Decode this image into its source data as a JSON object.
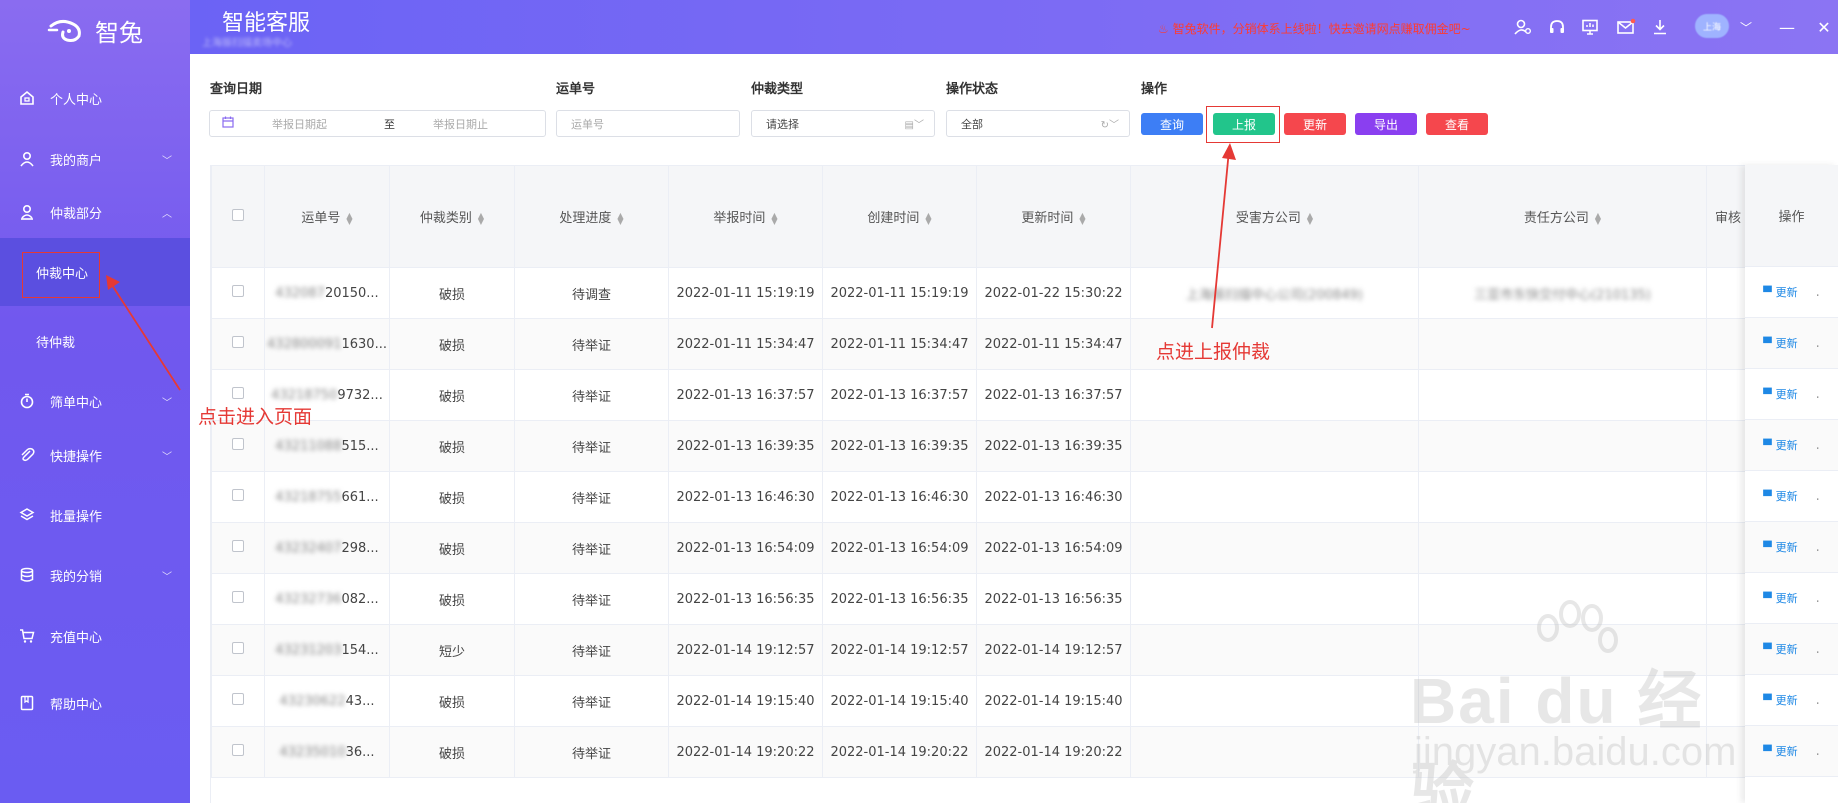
{
  "brand": {
    "name": "智兔"
  },
  "sidebar": {
    "items": [
      {
        "label": "个人中心",
        "icon": "house-icon"
      },
      {
        "label": "我的商户",
        "icon": "user-icon",
        "chevron": true
      },
      {
        "label": "仲裁部分",
        "icon": "user-icon",
        "chevron": true
      },
      {
        "label": "筛单中心",
        "icon": "timer-icon",
        "chevron": true
      },
      {
        "label": "快捷操作",
        "icon": "paperclip-icon",
        "chevron": true
      },
      {
        "label": "批量操作",
        "icon": "layers-icon"
      },
      {
        "label": "我的分销",
        "icon": "database-icon",
        "chevron": true
      },
      {
        "label": "充值中心",
        "icon": "cart-icon"
      },
      {
        "label": "帮助中心",
        "icon": "book-icon"
      }
    ],
    "sub_items": [
      "仲裁中心",
      "待仲裁"
    ]
  },
  "header": {
    "title": "智能客服",
    "subtitle": "上海振扫描卖场中心",
    "notice": "♨ 智兔软件，分销体系上线啦！快去邀请网点赚取佣金吧~",
    "avatar_text": "上海"
  },
  "filters": {
    "date_label": "查询日期",
    "date_start_placeholder": "举报日期起",
    "date_sep": "至",
    "date_end_placeholder": "举报日期止",
    "waybill_label": "运单号",
    "waybill_placeholder": "运单号",
    "type_label": "仲裁类型",
    "type_value": "请选择",
    "status_label": "操作状态",
    "status_value": "全部",
    "ops_label": "操作"
  },
  "buttons": {
    "query": "查询",
    "report": "上报",
    "update": "更新",
    "export": "导出",
    "view": "查看"
  },
  "colors": {
    "query": "#3d7ef5",
    "report": "#22c58b",
    "update": "#f5474d",
    "export": "#8a3ff0",
    "view": "#f5474d"
  },
  "table": {
    "columns": [
      "运单号",
      "仲裁类别",
      "处理进度",
      "举报时间",
      "创建时间",
      "更新时间",
      "受害方公司",
      "责任方公司",
      "审核",
      "操作"
    ],
    "op_label": "更新",
    "rows": [
      {
        "waybill_hidden": "432087",
        "waybill": "20150...",
        "type": "破损",
        "progress": "待调查",
        "report": "2022-01-11 15:19:19",
        "created": "2022-01-11 15:19:19",
        "updated": "2022-01-22 15:30:22",
        "victim": "上海振扫描中心公司(200849)",
        "resp": "三亚市东快交付中心(210135)"
      },
      {
        "waybill_hidden": "432800091",
        "waybill": "1630...",
        "type": "破损",
        "progress": "待举证",
        "report": "2022-01-11 15:34:47",
        "created": "2022-01-11 15:34:47",
        "updated": "2022-01-11 15:34:47",
        "victim": "",
        "resp": ""
      },
      {
        "waybill_hidden": "43218750",
        "waybill": "9732...",
        "type": "破损",
        "progress": "待举证",
        "report": "2022-01-13 16:37:57",
        "created": "2022-01-13 16:37:57",
        "updated": "2022-01-13 16:37:57",
        "victim": "",
        "resp": ""
      },
      {
        "waybill_hidden": "43211088",
        "waybill": "515...",
        "type": "破损",
        "progress": "待举证",
        "report": "2022-01-13 16:39:35",
        "created": "2022-01-13 16:39:35",
        "updated": "2022-01-13 16:39:35",
        "victim": "",
        "resp": ""
      },
      {
        "waybill_hidden": "43218755",
        "waybill": "661...",
        "type": "破损",
        "progress": "待举证",
        "report": "2022-01-13 16:46:30",
        "created": "2022-01-13 16:46:30",
        "updated": "2022-01-13 16:46:30",
        "victim": "",
        "resp": ""
      },
      {
        "waybill_hidden": "43232407",
        "waybill": "298...",
        "type": "破损",
        "progress": "待举证",
        "report": "2022-01-13 16:54:09",
        "created": "2022-01-13 16:54:09",
        "updated": "2022-01-13 16:54:09",
        "victim": "",
        "resp": ""
      },
      {
        "waybill_hidden": "43232736",
        "waybill": "082...",
        "type": "破损",
        "progress": "待举证",
        "report": "2022-01-13 16:56:35",
        "created": "2022-01-13 16:56:35",
        "updated": "2022-01-13 16:56:35",
        "victim": "",
        "resp": ""
      },
      {
        "waybill_hidden": "43231203",
        "waybill": "154...",
        "type": "短少",
        "progress": "待举证",
        "report": "2022-01-14 19:12:57",
        "created": "2022-01-14 19:12:57",
        "updated": "2022-01-14 19:12:57",
        "victim": "",
        "resp": ""
      },
      {
        "waybill_hidden": "43230622",
        "waybill": "43...",
        "type": "破损",
        "progress": "待举证",
        "report": "2022-01-14 19:15:40",
        "created": "2022-01-14 19:15:40",
        "updated": "2022-01-14 19:15:40",
        "victim": "",
        "resp": ""
      },
      {
        "waybill_hidden": "43235010",
        "waybill": "36...",
        "type": "破损",
        "progress": "待举证",
        "report": "2022-01-14 19:20:22",
        "created": "2022-01-14 19:20:22",
        "updated": "2022-01-14 19:20:22",
        "victim": "",
        "resp": ""
      }
    ]
  },
  "annotations": {
    "left": "点击进入页面",
    "right": "点进上报仲裁"
  },
  "watermark": {
    "brand": "Bai du 经验",
    "url": "jingyan.baidu.com"
  }
}
